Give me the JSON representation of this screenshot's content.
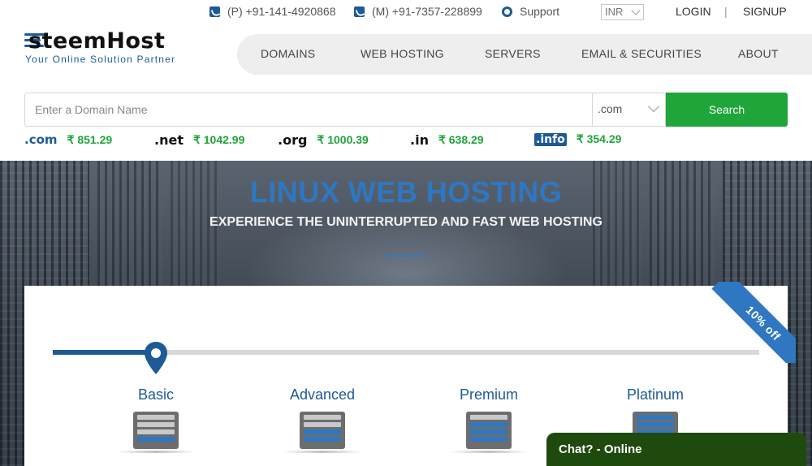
{
  "topbar": {
    "phone_p": "(P) +91-141-4920868",
    "phone_m": "(M) +91-7357-228899",
    "support": "Support",
    "currency": "INR",
    "login": "LOGIN",
    "separator": "|",
    "signup": "SIGNUP"
  },
  "logo": {
    "text": "steemHost",
    "tagline": "Your Online Solution Partner"
  },
  "nav": {
    "items": [
      "DOMAINS",
      "WEB HOSTING",
      "SERVERS",
      "EMAIL & SECURITIES",
      "ABOUT"
    ]
  },
  "search": {
    "placeholder": "Enter a Domain Name",
    "tld": ".com",
    "button": "Search"
  },
  "tlds": [
    {
      "name": ".com",
      "price": "₹ 851.29"
    },
    {
      "name": ".net",
      "price": "₹ 1042.99"
    },
    {
      "name": ".org",
      "price": "₹ 1000.39"
    },
    {
      "name": ".in",
      "price": "₹ 638.29"
    },
    {
      "name": ".info",
      "price": "₹ 354.29"
    }
  ],
  "hero": {
    "title": "LINUX WEB HOSTING",
    "subtitle": "EXPERIENCE THE UNINTERRUPTED AND FAST WEB HOSTING"
  },
  "pricing": {
    "ribbon": "10% off",
    "slider_fraction": 0.145,
    "plans": [
      {
        "name": "Basic",
        "active_bars": 1
      },
      {
        "name": "Advanced",
        "active_bars": 2
      },
      {
        "name": "Premium",
        "active_bars": 3
      },
      {
        "name": "Platinum",
        "active_bars": 4
      }
    ]
  },
  "chat": {
    "label": "Chat? - Online"
  },
  "colors": {
    "brand_blue": "#1e5a96",
    "accent_blue": "#2f77c0",
    "search_green": "#1fa53a",
    "chat_green": "#1f4a0e"
  }
}
